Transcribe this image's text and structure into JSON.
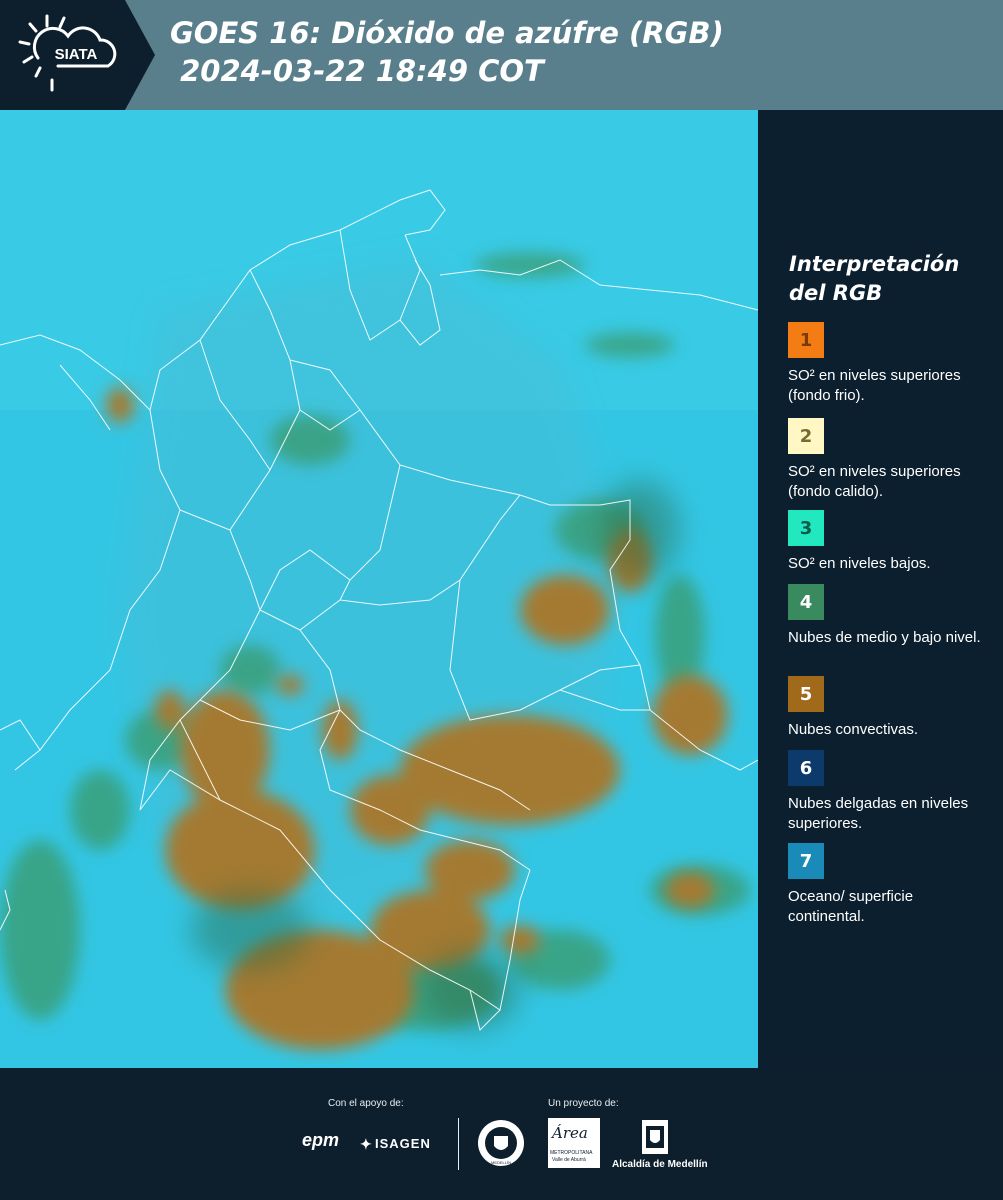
{
  "header": {
    "logo_text": "SIATA",
    "title_line1": "GOES 16: Dióxido de azúfre (RGB)",
    "title_line2": " 2024-03-22 18:49 COT"
  },
  "legend": {
    "title": "Interpretación del RGB",
    "items": [
      {
        "num": "1",
        "text": "SO² en niveles superiores (fondo frio).",
        "color": "#f47c15",
        "numcolor": "#7a3a05"
      },
      {
        "num": "2",
        "text": "SO² en niveles superiores (fondo calido).",
        "color": "#fff8c4",
        "numcolor": "#7a6a30"
      },
      {
        "num": "3",
        "text": "SO² en niveles bajos.",
        "color": "#22e8c0",
        "numcolor": "#0a5a4a"
      },
      {
        "num": "4",
        "text": "Nubes de medio y bajo nivel.",
        "color": "#3a8a60",
        "numcolor": "#ffffff"
      },
      {
        "num": "5",
        "text": "Nubes convectivas.",
        "color": "#a06a1a",
        "numcolor": "#ffffff"
      },
      {
        "num": "6",
        "text": "Nubes delgadas en niveles superiores.",
        "color": "#0c3a6a",
        "numcolor": "#ffffff"
      },
      {
        "num": "7",
        "text": "Oceano/ superficie continental.",
        "color": "#1a8ab8",
        "numcolor": "#ffffff"
      }
    ]
  },
  "footer": {
    "support_label": "Con el apoyo de:",
    "project_label": "Un proyecto de:",
    "epm": "epm",
    "isagen": "ISAGEN",
    "area_word": "Área",
    "area_caption": "METROPOLITANA",
    "area_caption2": "Valle de Aburrá",
    "alcaldia": "Alcaldía de Medellín",
    "medellin_seal_text": "MEDELLÍN"
  },
  "colors": {
    "header_bg": "#5a7f8c",
    "page_bg": "#0d1f2d",
    "ocean": "#2ec4e2",
    "convective": "#a07830",
    "low_cloud": "#3a9a6a"
  }
}
